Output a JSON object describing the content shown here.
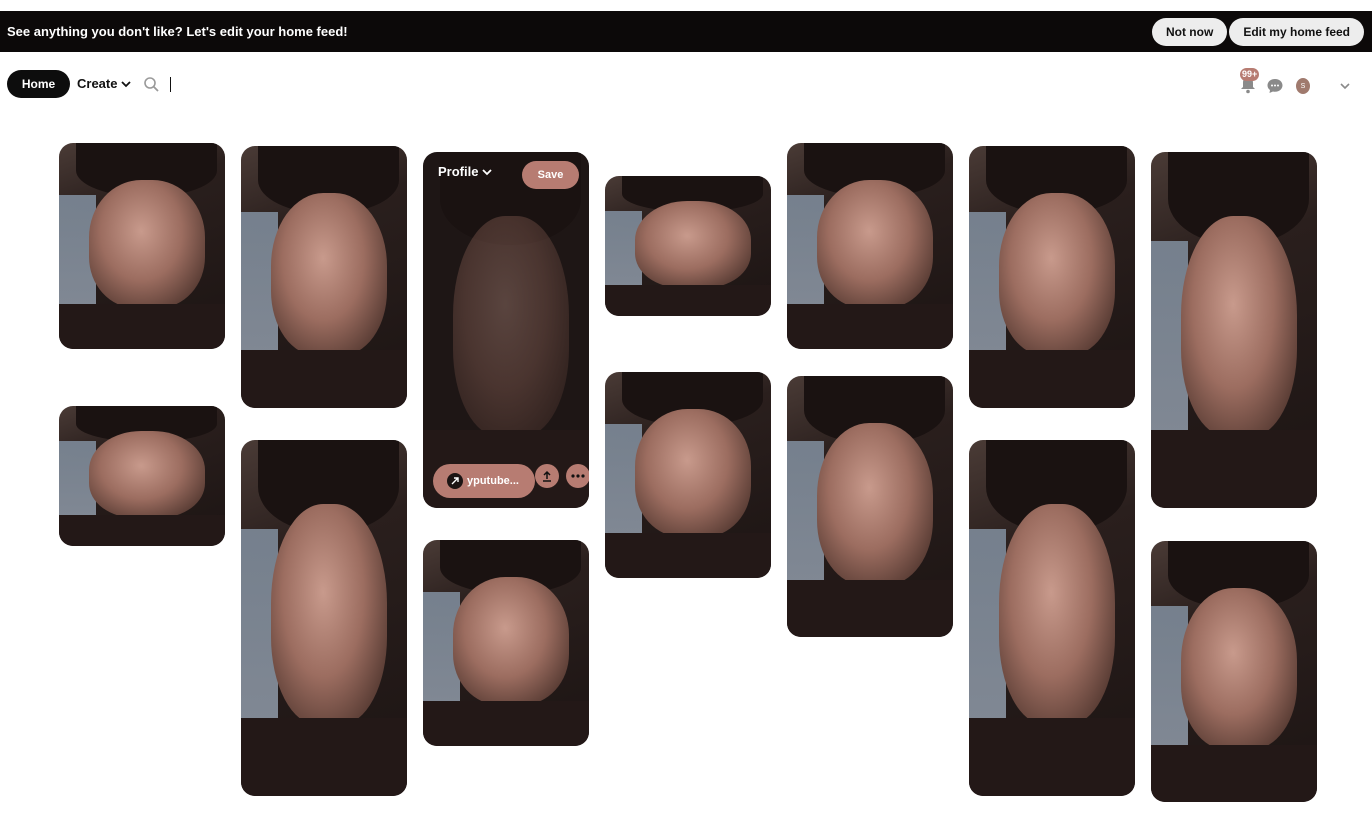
{
  "banner": {
    "text": "See anything you don't like? Let's edit your home feed!",
    "not_now": "Not now",
    "edit_feed": "Edit my home feed"
  },
  "topbar": {
    "home": "Home",
    "create": "Create",
    "notification_badge": "99+",
    "avatar_letter": "S"
  },
  "hovered_pin": {
    "board_select": "Profile",
    "save": "Save",
    "link": "yputube..."
  },
  "colors": {
    "accent": "#b77c72",
    "banner_bg": "#0c0909"
  }
}
